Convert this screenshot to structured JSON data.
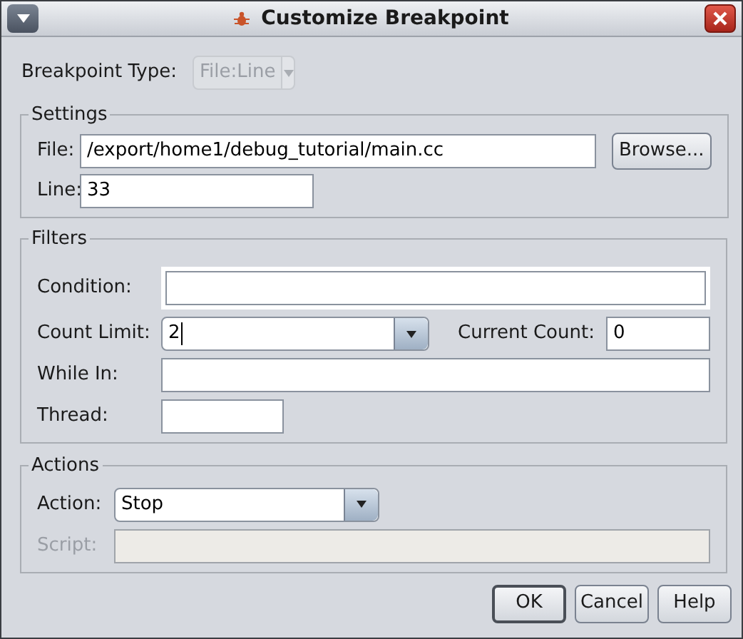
{
  "window": {
    "title": "Customize Breakpoint"
  },
  "breakpoint_type": {
    "label": "Breakpoint Type:",
    "value": "File:Line",
    "disabled": true
  },
  "settings": {
    "legend": "Settings",
    "file": {
      "label": "File:",
      "value": "/export/home1/debug_tutorial/main.cc"
    },
    "browse_button": "Browse...",
    "line": {
      "label": "Line:",
      "value": "33"
    }
  },
  "filters": {
    "legend": "Filters",
    "condition": {
      "label": "Condition:"
    },
    "count_limit": {
      "label": "Count Limit:",
      "value": "2",
      "focused": true
    },
    "current_count": {
      "label": "Current Count:",
      "value": "0"
    },
    "while_in": {
      "label": "While In:"
    },
    "thread": {
      "label": "Thread:"
    }
  },
  "actions": {
    "legend": "Actions",
    "action": {
      "label": "Action:",
      "value": "Stop",
      "disabled": false
    },
    "script": {
      "label": "Script:",
      "disabled": true
    }
  },
  "buttons": [
    {
      "label": "OK",
      "default": true
    },
    {
      "label": "Cancel",
      "default": false
    },
    {
      "label": "Help",
      "default": false
    }
  ]
}
